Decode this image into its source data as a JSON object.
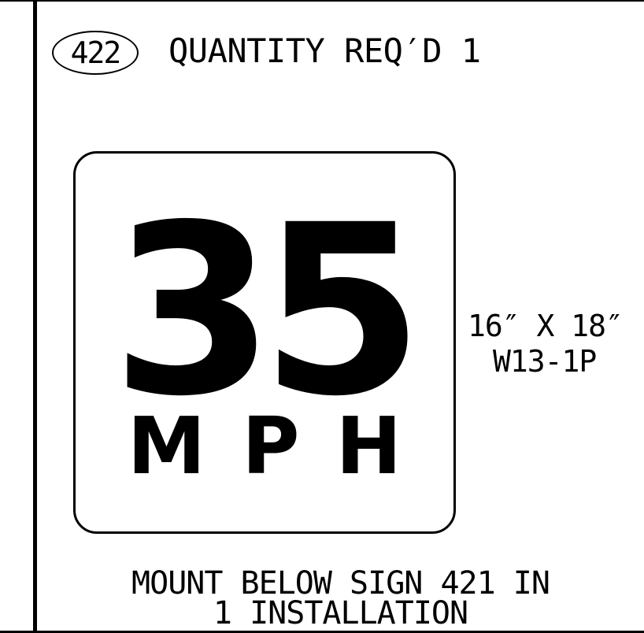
{
  "sheet": {
    "sign_number": "422",
    "quantity_text": "QUANTITY REQ′D 1"
  },
  "sign": {
    "speed": "35",
    "units": "MPH",
    "size": "16″ X 18″",
    "code": "W13-1P",
    "background_color": "#ffffff",
    "legend_color": "#000000"
  },
  "note": {
    "line1": "MOUNT BELOW SIGN 421 IN",
    "line2": "1 INSTALLATION"
  }
}
